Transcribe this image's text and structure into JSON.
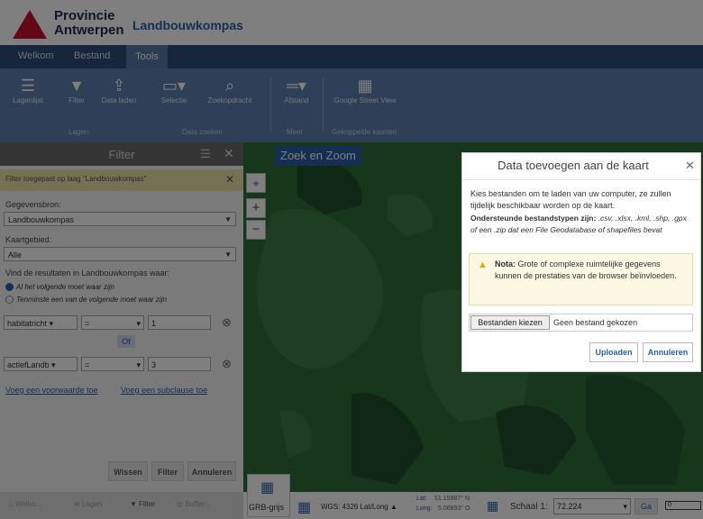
{
  "brand": {
    "line1": "Provincie",
    "line2": "Antwerpen",
    "app_title": "Landbouwkompas"
  },
  "tabs": [
    "Welkom",
    "Bestand",
    "Tools"
  ],
  "toolbar": {
    "items": [
      {
        "label": "Lagenlijst",
        "icon": "layers-icon"
      },
      {
        "label": "Filter",
        "icon": "filter-icon"
      },
      {
        "label": "Data laden",
        "icon": "upload-icon"
      },
      {
        "label": "Selectie",
        "icon": "select-icon"
      },
      {
        "label": "Zoekopdracht",
        "icon": "search-icon"
      },
      {
        "label": "Afstand",
        "icon": "ruler-icon"
      },
      {
        "label": "Google Street View",
        "icon": "streetview-icon"
      }
    ],
    "groups": [
      "Lagen",
      "Data zoeken",
      "Meet",
      "Gekoppelde kaarten"
    ]
  },
  "panel": {
    "title": "Filter",
    "notice": "Filter toegepast op laag \"Landbouwkompas\"",
    "source_label": "Gegevensbron:",
    "source_value": "Landbouwkompas",
    "area_label": "Kaartgebied:",
    "area_value": "Alle",
    "intro": "Vind de resultaten in Landbouwkompas waar:",
    "radio_all": "Al het volgende moet waar zijn",
    "radio_any": "Tenminste een van de volgende moet waar zijn",
    "conditions": [
      {
        "field": "habitatricht",
        "operator": "=",
        "value": "1"
      },
      {
        "field": "actiefLandb",
        "operator": "=",
        "value": "3"
      }
    ],
    "or_label": "Of",
    "add_condition": "Voeg een voorwaarde toe",
    "add_subclause": "Voeg een subclause toe",
    "buttons": {
      "clear": "Wissen",
      "filter": "Filter",
      "cancel": "Annuleren"
    },
    "bottom_tabs": [
      "Welko...",
      "Lagen",
      "Filter",
      "Buffer..."
    ]
  },
  "map": {
    "title": "Zoek en Zoom",
    "basemap_label": "GRB-grijs",
    "crs": "WGS: 4326 Lat/Long",
    "lat_label": "Lat:",
    "lat_value": "51.15987° N",
    "lon_label": "Long:",
    "lon_value": "5.06893° O",
    "scale_label": "Schaal 1:",
    "scale_value": "72.224",
    "go_label": "Ga",
    "scalebar_label": "0"
  },
  "dialog": {
    "title": "Data toevoegen aan de kaart",
    "intro": "Kies bestanden om te laden van uw computer, ze zullen tijdelijk beschikbaar worden op de kaart.",
    "types_bold": "Ondersteunde bestandstypen zijn:",
    "types_list": " .csv, .xlsx, .kml, .shp, .gpx of een .zip dat een File Geodatabase of shapefiles bevat",
    "note_bold": "Nota:",
    "note_text": " Grote of complexe ruimtelijke gegevens kunnen de prestaties van de browser beïnvloeden.",
    "choose_label": "Bestanden kiezen",
    "file_status": "Geen bestand gekozen",
    "upload_label": "Uploaden",
    "cancel_label": "Annuleren"
  },
  "colors": {
    "brand_red": "#c8102e",
    "accent": "#2a5ea8",
    "map_green": "#2b6b35",
    "map_dark": "#1d4d25"
  }
}
